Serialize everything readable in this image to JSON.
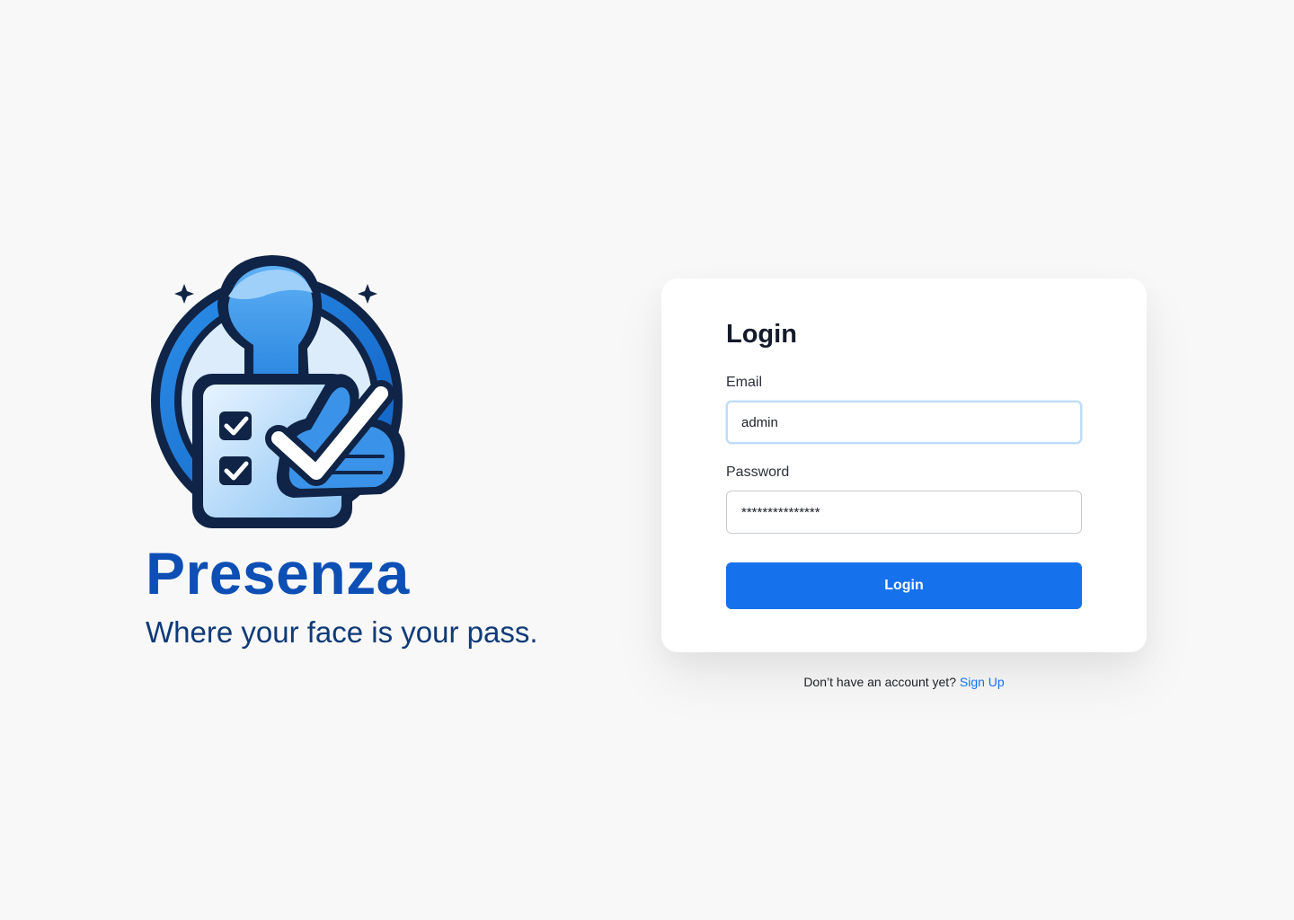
{
  "brand": {
    "name": "Presenza",
    "tagline": "Where your face is your pass.",
    "logo_icon": "person-checklist-thumbs-up-logo"
  },
  "login_form": {
    "title": "Login",
    "email": {
      "label": "Email",
      "value": "admin"
    },
    "password": {
      "label": "Password",
      "value": "***************"
    },
    "submit_label": "Login"
  },
  "signup_prompt": {
    "text": "Don’t have an account yet?",
    "link_label": "Sign Up"
  },
  "colors": {
    "background": "#f8f8f8",
    "brand_blue": "#0d4fb5",
    "tagline_navy": "#0e3a78",
    "button_blue": "#1671ec",
    "link_blue": "#1671ec",
    "focus_ring": "#bfdcf8"
  }
}
